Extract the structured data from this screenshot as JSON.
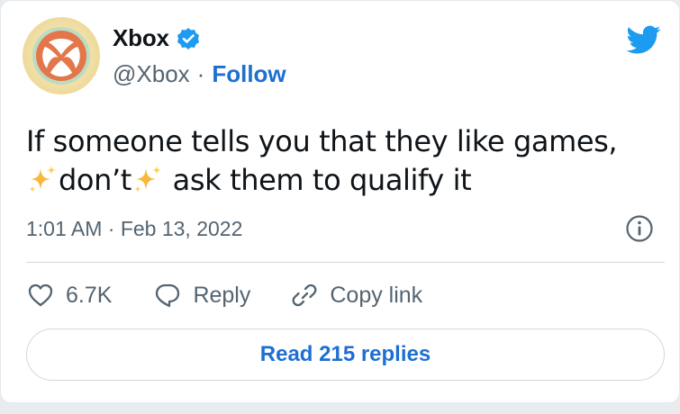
{
  "author": {
    "display_name": "Xbox",
    "handle": "@Xbox",
    "separator": "·",
    "follow_label": "Follow",
    "verified": true
  },
  "tweet": {
    "line1": "If someone tells you that they like games,",
    "word_dont": "don’t",
    "line2_rest": " ask them to qualify it",
    "timestamp": "1:01 AM · Feb 13, 2022"
  },
  "actions": {
    "like_count": "6.7K",
    "reply_label": "Reply",
    "copy_link_label": "Copy link"
  },
  "read_replies_label": "Read 215 replies",
  "colors": {
    "accent": "#1d6fd1",
    "text_primary": "#0f1419",
    "text_secondary": "#536471",
    "twitter_blue": "#1d9bf0",
    "border": "#cfd9de"
  },
  "icons": {
    "avatar": "xbox-logo",
    "verified": "verified-badge-icon",
    "brand": "twitter-bird-icon",
    "sparkles": "sparkles-icon",
    "info": "info-icon",
    "like": "heart-icon",
    "reply": "speech-bubble-icon",
    "copy_link": "link-icon"
  }
}
